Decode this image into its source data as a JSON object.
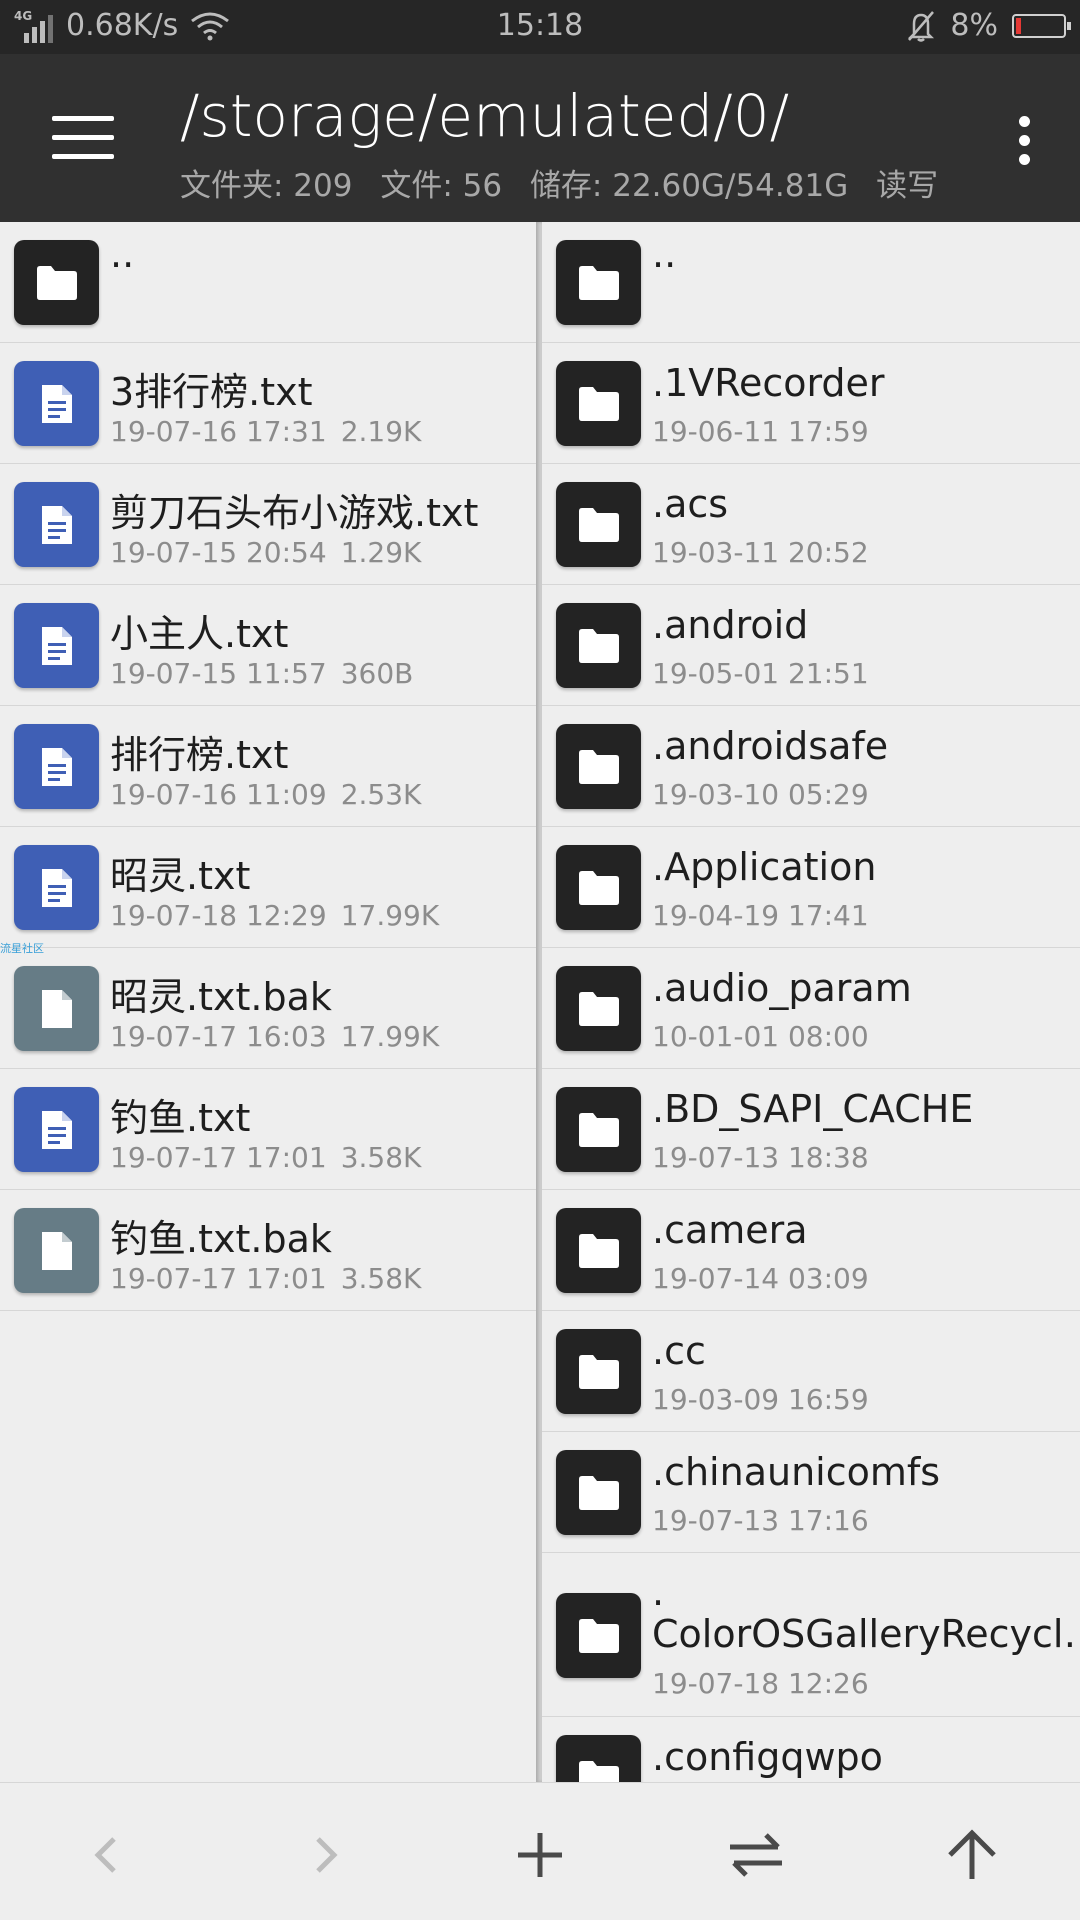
{
  "status_bar": {
    "network": "4G",
    "speed": "0.68K/s",
    "time": "15:18",
    "battery": "8%",
    "battery_color": "#e53935"
  },
  "app_bar": {
    "path": "/storage/emulated/0/",
    "folders": "文件夹: 209",
    "files": "文件: 56",
    "storage": "储存: 22.60G/54.81G",
    "mode": "读写"
  },
  "left_pane": {
    "watermark": "流星社区",
    "items": [
      {
        "name": "..",
        "type": "folder",
        "date": "",
        "size": ""
      },
      {
        "name": "3排行榜.txt",
        "type": "txt",
        "date": "19-07-16 17:31",
        "size": "2.19K"
      },
      {
        "name": "剪刀石头布小游戏.txt",
        "type": "txt",
        "date": "19-07-15 20:54",
        "size": "1.29K"
      },
      {
        "name": "小主人.txt",
        "type": "txt",
        "date": "19-07-15 11:57",
        "size": "360B"
      },
      {
        "name": "排行榜.txt",
        "type": "txt",
        "date": "19-07-16 11:09",
        "size": "2.53K"
      },
      {
        "name": "昭灵.txt",
        "type": "txt",
        "date": "19-07-18 12:29",
        "size": "17.99K"
      },
      {
        "name": "昭灵.txt.bak",
        "type": "bak",
        "date": "19-07-17 16:03",
        "size": "17.99K"
      },
      {
        "name": "钓鱼.txt",
        "type": "txt",
        "date": "19-07-17 17:01",
        "size": "3.58K"
      },
      {
        "name": "钓鱼.txt.bak",
        "type": "bak",
        "date": "19-07-17 17:01",
        "size": "3.58K"
      }
    ]
  },
  "right_pane": {
    "items": [
      {
        "name": "..",
        "date": ""
      },
      {
        "name": ".1VRecorder",
        "date": "19-06-11 17:59"
      },
      {
        "name": ".acs",
        "date": "19-03-11 20:52"
      },
      {
        "name": ".android",
        "date": "19-05-01 21:51"
      },
      {
        "name": ".androidsafe",
        "date": "19-03-10 05:29"
      },
      {
        "name": ".Application",
        "date": "19-04-19 17:41"
      },
      {
        "name": ".audio_param",
        "date": "10-01-01 08:00"
      },
      {
        "name": ".BD_SAPI_CACHE",
        "date": "19-07-13 18:38"
      },
      {
        "name": ".camera",
        "date": "19-07-14 03:09"
      },
      {
        "name": ".cc",
        "date": "19-03-09 16:59"
      },
      {
        "name": ".chinaunicomfs",
        "date": "19-07-13 17:16"
      },
      {
        "name": ". ColorOSGalleryRecycl…",
        "date": "19-07-18 12:26",
        "tall": true
      },
      {
        "name": ".configqwpo",
        "date": ""
      }
    ]
  },
  "bottom_bar": {
    "icons": [
      "back-icon",
      "forward-icon",
      "add-icon",
      "swap-icon",
      "up-icon"
    ]
  }
}
